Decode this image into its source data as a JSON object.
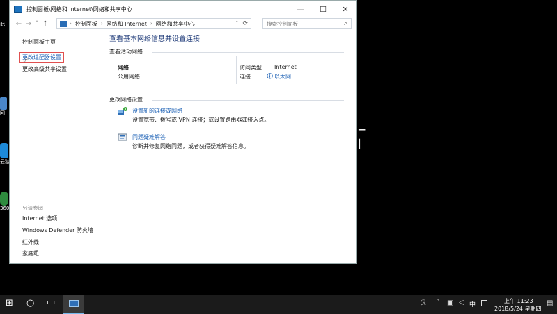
{
  "window": {
    "title": "控制面板\\网络和 Internet\\网络和共享中心",
    "minimize": "—",
    "maximize": "☐",
    "close": "✕"
  },
  "nav": {
    "back": "←",
    "forward": "→",
    "recent": "˅",
    "up": "↑"
  },
  "address": {
    "crumbs": [
      "控制面板",
      "网络和 Internet",
      "网络和共享中心"
    ],
    "separator": "›",
    "dropdown": "˅",
    "refresh": "⟳"
  },
  "search": {
    "placeholder": "搜索控制面板",
    "icon": "⌕"
  },
  "left_pane": {
    "home": "控制面板主页",
    "change_adapter": "更改适配器设置",
    "advanced_sharing": "更改高级共享设置",
    "see_also": "另请参阅",
    "see_also_items": [
      "Internet 选项",
      "Windows Defender 防火墙",
      "红外线",
      "家庭组"
    ]
  },
  "main": {
    "title": "查看基本网络信息并设置连接",
    "active_networks": "查看活动网络",
    "network_name": "网络",
    "network_type": "公用网络",
    "access_type_label": "访问类型:",
    "access_type_value": "Internet",
    "connection_label": "连接:",
    "connection_value": "以太网",
    "change_settings": "更改网络设置",
    "tasks": [
      {
        "title": "设置新的连接或网络",
        "desc": "设置宽带、拨号或 VPN 连接；或设置路由器或接入点。"
      },
      {
        "title": "问题疑难解答",
        "desc": "诊断并修复网络问题，或者获得疑难解答信息。"
      }
    ]
  },
  "desktop": {
    "labels": [
      "此",
      "回",
      "云独",
      "360"
    ]
  },
  "taskbar": {
    "time": "上午 11:23",
    "date": "2018/5/24 星期四",
    "ime": "中",
    "windows_icon": "⊞",
    "cortana_icon": "○",
    "taskview_icon": "▭"
  },
  "colors": {
    "link": "#1a5fb4",
    "title": "#1e3a78",
    "taskbar": "#1b1b1b"
  }
}
